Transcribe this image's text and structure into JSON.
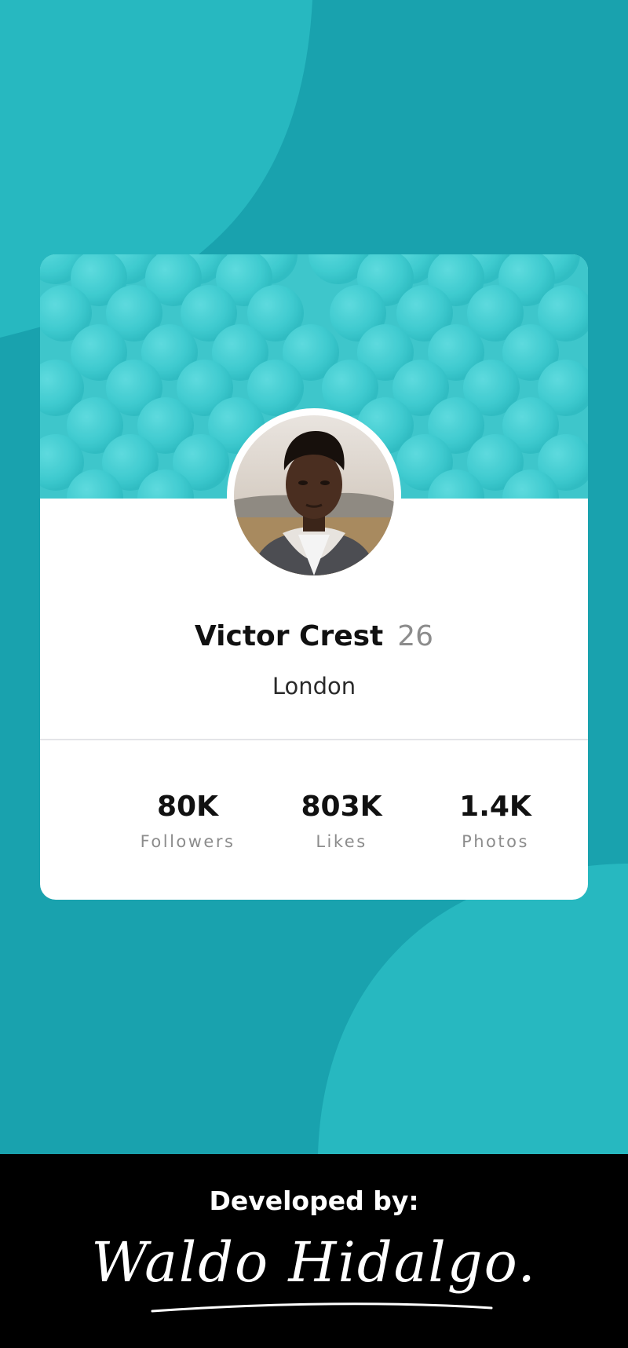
{
  "profile": {
    "name": "Victor Crest",
    "age": "26",
    "location": "London"
  },
  "stats": [
    {
      "value": "80K",
      "label": "Followers"
    },
    {
      "value": "803K",
      "label": "Likes"
    },
    {
      "value": "1.4K",
      "label": "Photos"
    }
  ],
  "footer": {
    "title": "Developed by:",
    "signature": "Waldo Hidalgo."
  },
  "colors": {
    "background": "#19a2ae",
    "header_pattern": "#3ec6cb",
    "card": "#ffffff",
    "footer": "#000000",
    "muted_text": "#8c8c8c"
  },
  "icons": {
    "avatar": "user-portrait"
  }
}
